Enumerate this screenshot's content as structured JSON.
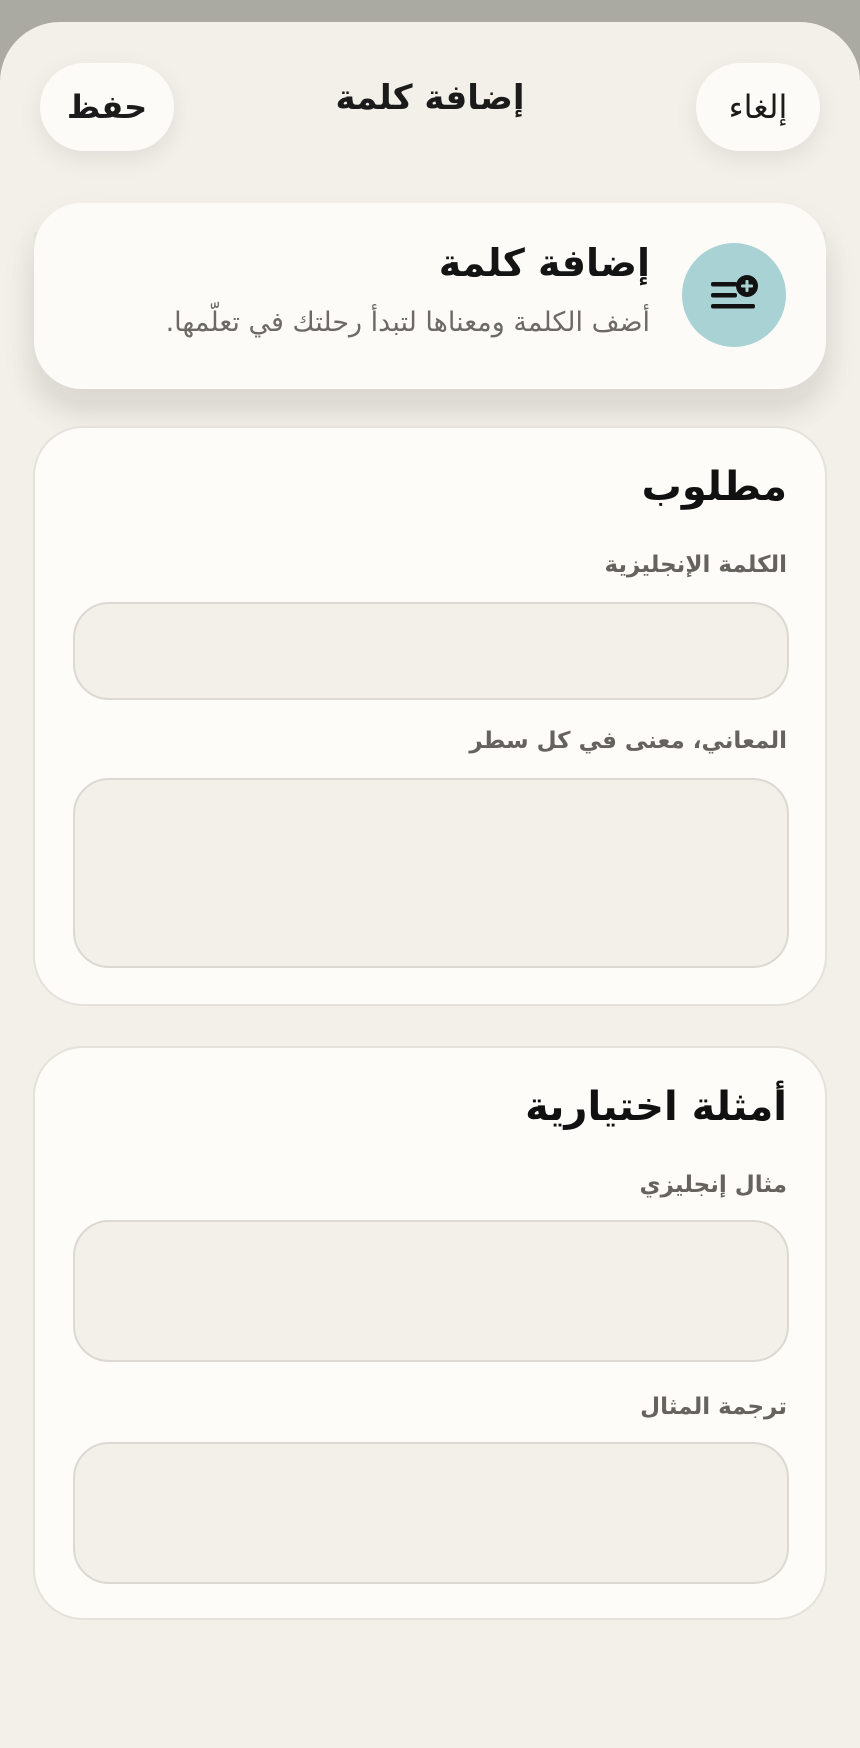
{
  "nav": {
    "cancel_label": "إلغاء",
    "title": "إضافة كلمة",
    "save_label": "حفظ"
  },
  "hero": {
    "title": "إضافة كلمة",
    "subtitle": "أضف الكلمة ومعناها لتبدأ رحلتك في تعلّمها.",
    "icon": "add-list-icon",
    "icon_bg": "#a9d2d5"
  },
  "required": {
    "title": "مطلوب",
    "english_word_label": "الكلمة الإنجليزية",
    "english_word_value": "",
    "meanings_label": "المعاني، معنى في كل سطر",
    "meanings_value": ""
  },
  "optional": {
    "title": "أمثلة اختيارية",
    "example_label": "مثال إنجليزي",
    "example_value": "",
    "translation_label": "ترجمة المثال",
    "translation_value": ""
  },
  "colors": {
    "background": "#f3efe9",
    "card": "#fdfcf8",
    "accent": "#a9d2d5",
    "text": "#1b1b1b"
  }
}
